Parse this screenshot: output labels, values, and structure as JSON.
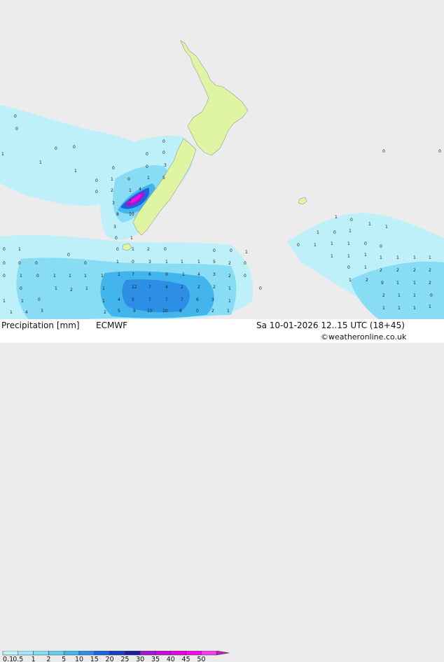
{
  "header": {
    "title": "Precipitation [mm]",
    "model": "ECMWF",
    "valid_time": "Sa 10-01-2026 12..15 UTC (18+45)",
    "credit": "©weatheronline.co.uk"
  },
  "legend": {
    "tick_labels": [
      "0.1",
      "0.5",
      "1",
      "2",
      "5",
      "10",
      "15",
      "20",
      "25",
      "30",
      "35",
      "40",
      "45",
      "50"
    ],
    "colors": [
      "#bef0fa",
      "#a3e6f7",
      "#88dcf4",
      "#66cdf0",
      "#42b6ec",
      "#2d8ee6",
      "#1a64de",
      "#1840c0",
      "#1e1ea0",
      "#9c1ad0",
      "#c20ed2",
      "#e00ad6",
      "#f20ce8",
      "#f43cf0",
      "#c818c0"
    ]
  },
  "colors": {
    "sea": "#ececec",
    "land": "#e0f5a4",
    "border": "#999999"
  },
  "map_values": [
    "0",
    "1",
    "2",
    "3",
    "4",
    "5",
    "6",
    "7",
    "8",
    "9",
    "10",
    "12"
  ]
}
